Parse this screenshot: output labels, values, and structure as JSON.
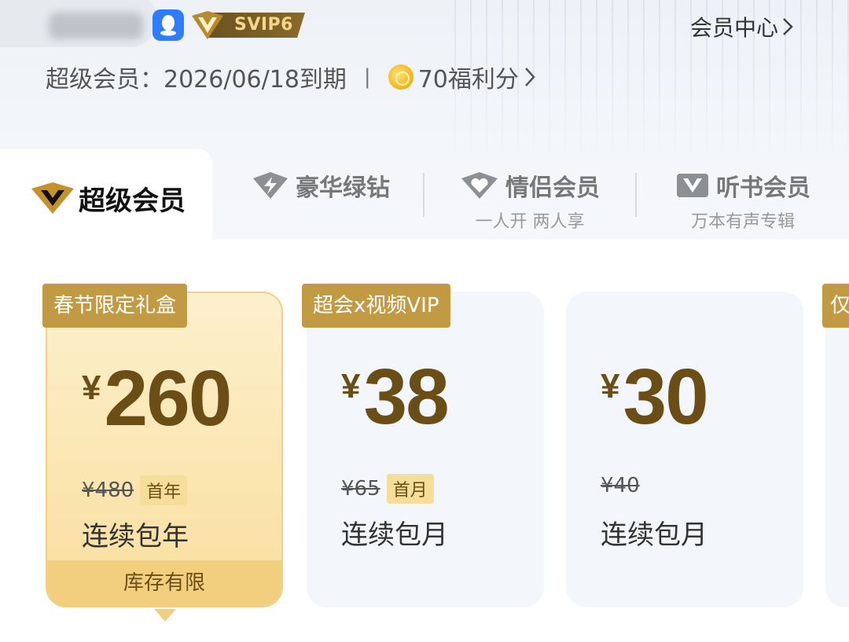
{
  "header": {
    "member_center_label": "会员中心",
    "svip_level": "SVIP6",
    "expiry_text": "超级会员：2026/06/18到期",
    "separator": "|",
    "points_text": "70福利分"
  },
  "tabs": [
    {
      "label": "超级会员",
      "sub": "",
      "active": true,
      "icon": "diamond-v-icon"
    },
    {
      "label": "豪华绿钻",
      "sub": "",
      "active": false,
      "icon": "lightning-diamond-icon"
    },
    {
      "label": "情侣会员",
      "sub": "一人开 两人享",
      "active": false,
      "icon": "heart-diamond-icon"
    },
    {
      "label": "听书会员",
      "sub": "万本有声专辑",
      "active": false,
      "icon": "book-v-icon"
    }
  ],
  "plans": [
    {
      "tag": "春节限定礼盒",
      "currency": "¥",
      "price": "260",
      "original": "¥480",
      "badge": "首年",
      "term": "连续包年",
      "footer": "库存有限"
    },
    {
      "tag": "超会x视频VIP",
      "currency": "¥",
      "price": "38",
      "original": "¥65",
      "badge": "首月",
      "term": "连续包月"
    },
    {
      "tag": "",
      "currency": "¥",
      "price": "30",
      "original": "¥40",
      "badge": "",
      "term": "连续包月"
    },
    {
      "tag": "仅",
      "currency": "",
      "price": "",
      "original": "",
      "badge": "",
      "term": ""
    }
  ],
  "colors": {
    "gold_dark": "#6b4e15",
    "tag_gold": "#c29a43",
    "featured_bg": "#fbe6b3",
    "qq_blue": "#2f7dff"
  }
}
